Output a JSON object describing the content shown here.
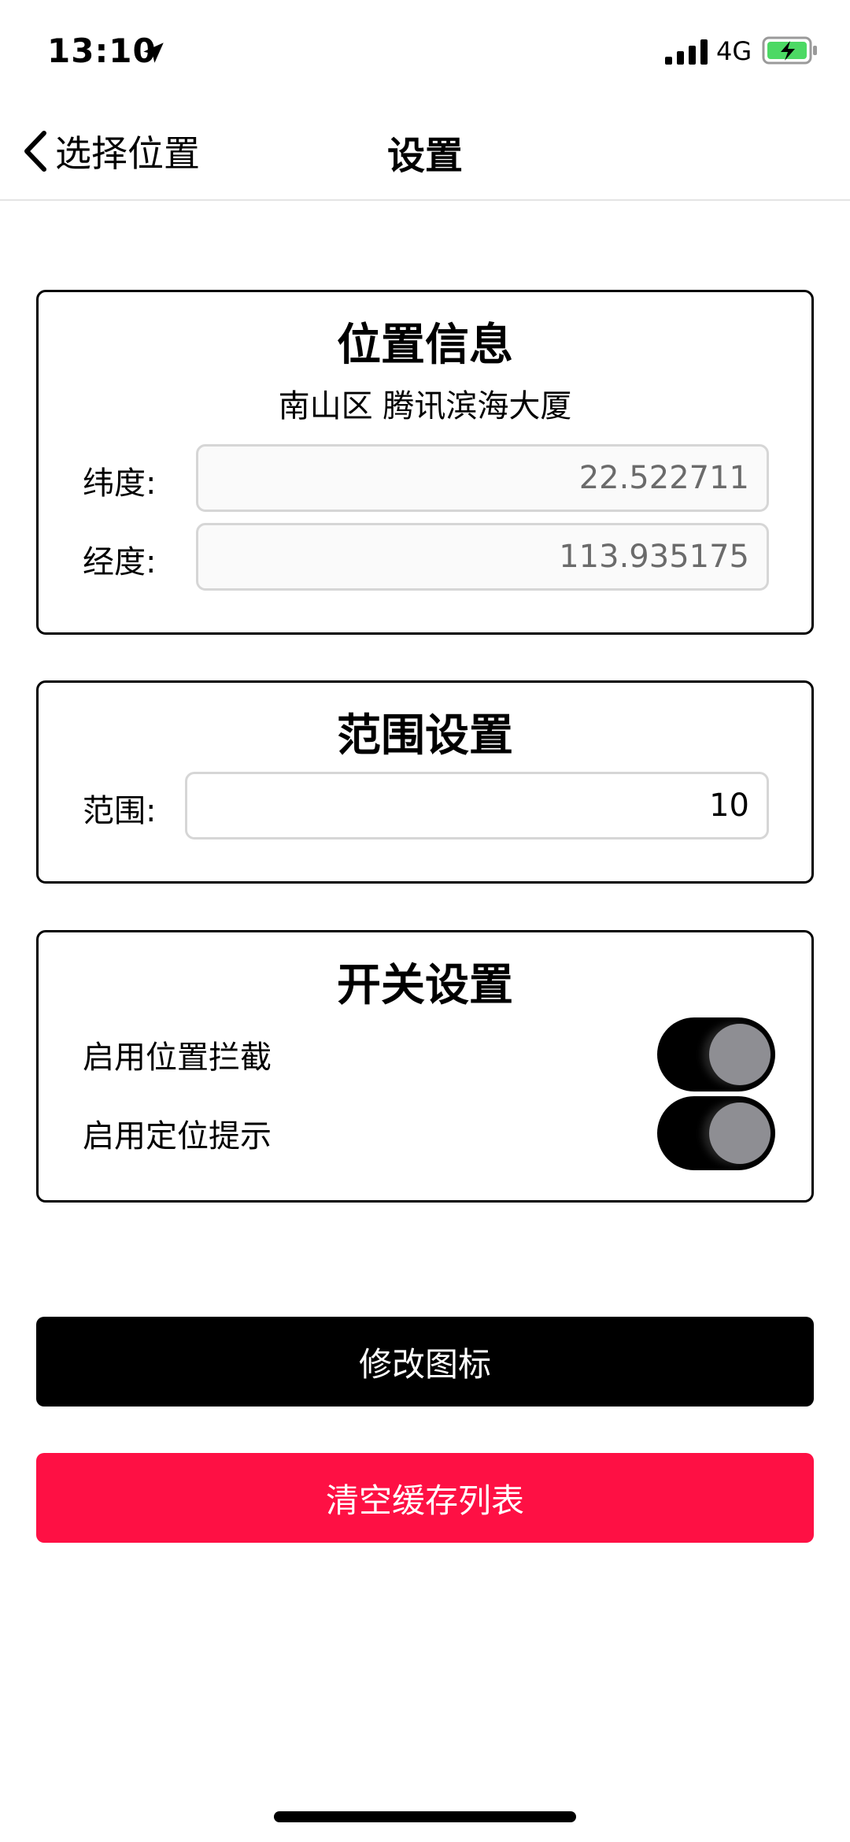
{
  "status_bar": {
    "time": "13:10",
    "network": "4G"
  },
  "nav": {
    "back_label": "选择位置",
    "title": "设置"
  },
  "location_card": {
    "title": "位置信息",
    "address": "南山区 腾讯滨海大厦",
    "latitude_label": "纬度:",
    "latitude_value": "22.522711",
    "longitude_label": "经度:",
    "longitude_value": "113.935175"
  },
  "range_card": {
    "title": "范围设置",
    "range_label": "范围:",
    "range_value": "10"
  },
  "switch_card": {
    "title": "开关设置",
    "switches": [
      {
        "label": "启用位置拦截",
        "on": true
      },
      {
        "label": "启用定位提示",
        "on": true
      }
    ]
  },
  "buttons": {
    "change_icon": "修改图标",
    "clear_cache": "清空缓存列表"
  },
  "colors": {
    "accent_red": "#fe1044",
    "toggle_track": "#000000",
    "toggle_knob": "#8e8e93"
  }
}
